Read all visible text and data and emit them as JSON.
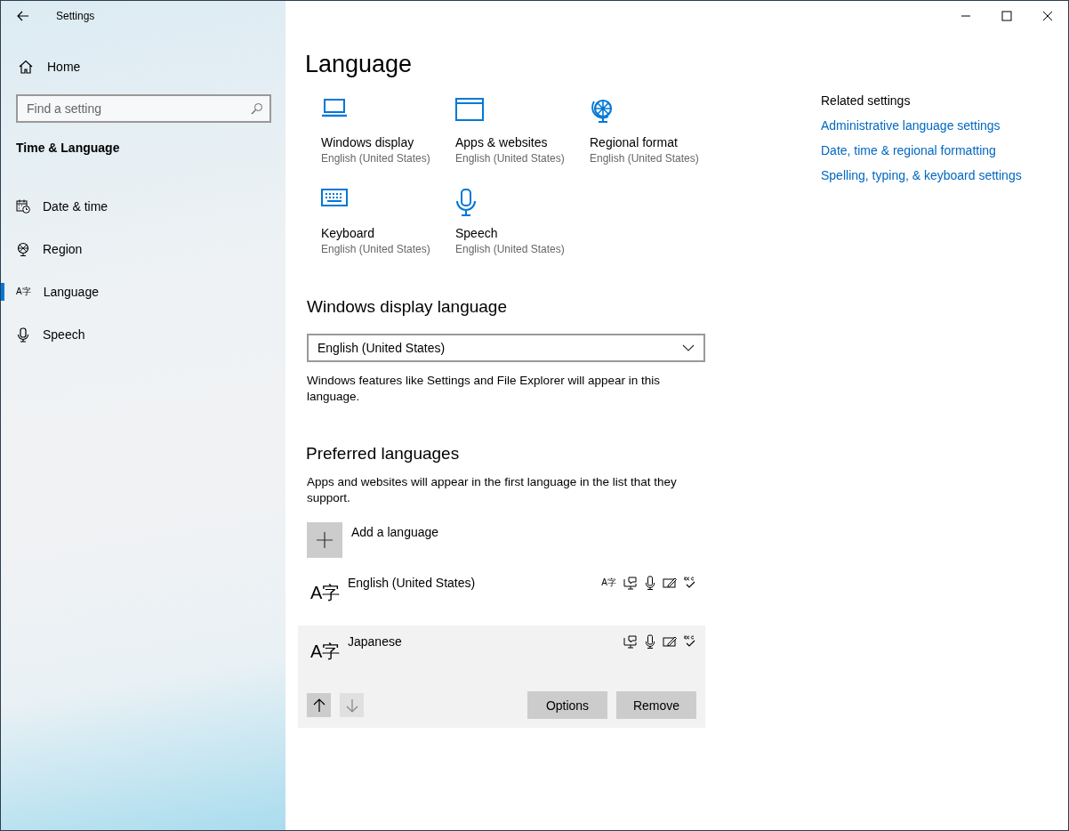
{
  "window": {
    "title": "Settings",
    "controls": [
      {
        "kind": "minimize"
      },
      {
        "kind": "maximize"
      },
      {
        "kind": "close"
      }
    ]
  },
  "sidebar": {
    "home": "Home",
    "search": {
      "placeholder": "Find a setting"
    },
    "section": "Time & Language",
    "items": [
      {
        "label": "Date & time",
        "kind": "calendar",
        "selected": false
      },
      {
        "label": "Region",
        "kind": "globe",
        "selected": false
      },
      {
        "label": "Language",
        "kind": "language",
        "glyph": "A字",
        "selected": true
      },
      {
        "label": "Speech",
        "kind": "mic",
        "selected": false
      }
    ]
  },
  "page": {
    "title": "Language",
    "tiles": [
      {
        "kind": "laptop",
        "label": "Windows display",
        "value": "English (United States)"
      },
      {
        "kind": "window",
        "label": "Apps & websites",
        "value": "English (United States)"
      },
      {
        "kind": "globe",
        "label": "Regional format",
        "value": "English (United States)"
      },
      {
        "kind": "keyboard",
        "label": "Keyboard",
        "value": "English (United States)"
      },
      {
        "kind": "mic",
        "label": "Speech",
        "value": "English (United States)"
      }
    ],
    "display_language": {
      "heading": "Windows display language",
      "value": "English (United States)",
      "note": "Windows features like Settings and File Explorer will appear in this language."
    },
    "preferred": {
      "heading": "Preferred languages",
      "note": "Apps and websites will appear in the first language in the list that they support.",
      "add": "Add a language",
      "languages": [
        {
          "glyph": "A字",
          "name": "English (United States)",
          "selected": false,
          "features": [
            {
              "kind": "display",
              "glyph": "A字"
            },
            {
              "kind": "tts"
            },
            {
              "kind": "speech"
            },
            {
              "kind": "handwriting"
            },
            {
              "kind": "spelling"
            }
          ]
        },
        {
          "glyph": "A字",
          "name": "Japanese",
          "selected": true,
          "features": [
            {
              "kind": "tts"
            },
            {
              "kind": "speech"
            },
            {
              "kind": "handwriting"
            },
            {
              "kind": "spelling"
            }
          ],
          "move_up": {
            "disabled": false
          },
          "move_down": {
            "disabled": true
          },
          "buttons": [
            "Options",
            "Remove"
          ]
        }
      ]
    }
  },
  "related": {
    "heading": "Related settings",
    "links": [
      "Administrative language settings",
      "Date, time & regional formatting",
      "Spelling, typing, & keyboard settings"
    ]
  }
}
